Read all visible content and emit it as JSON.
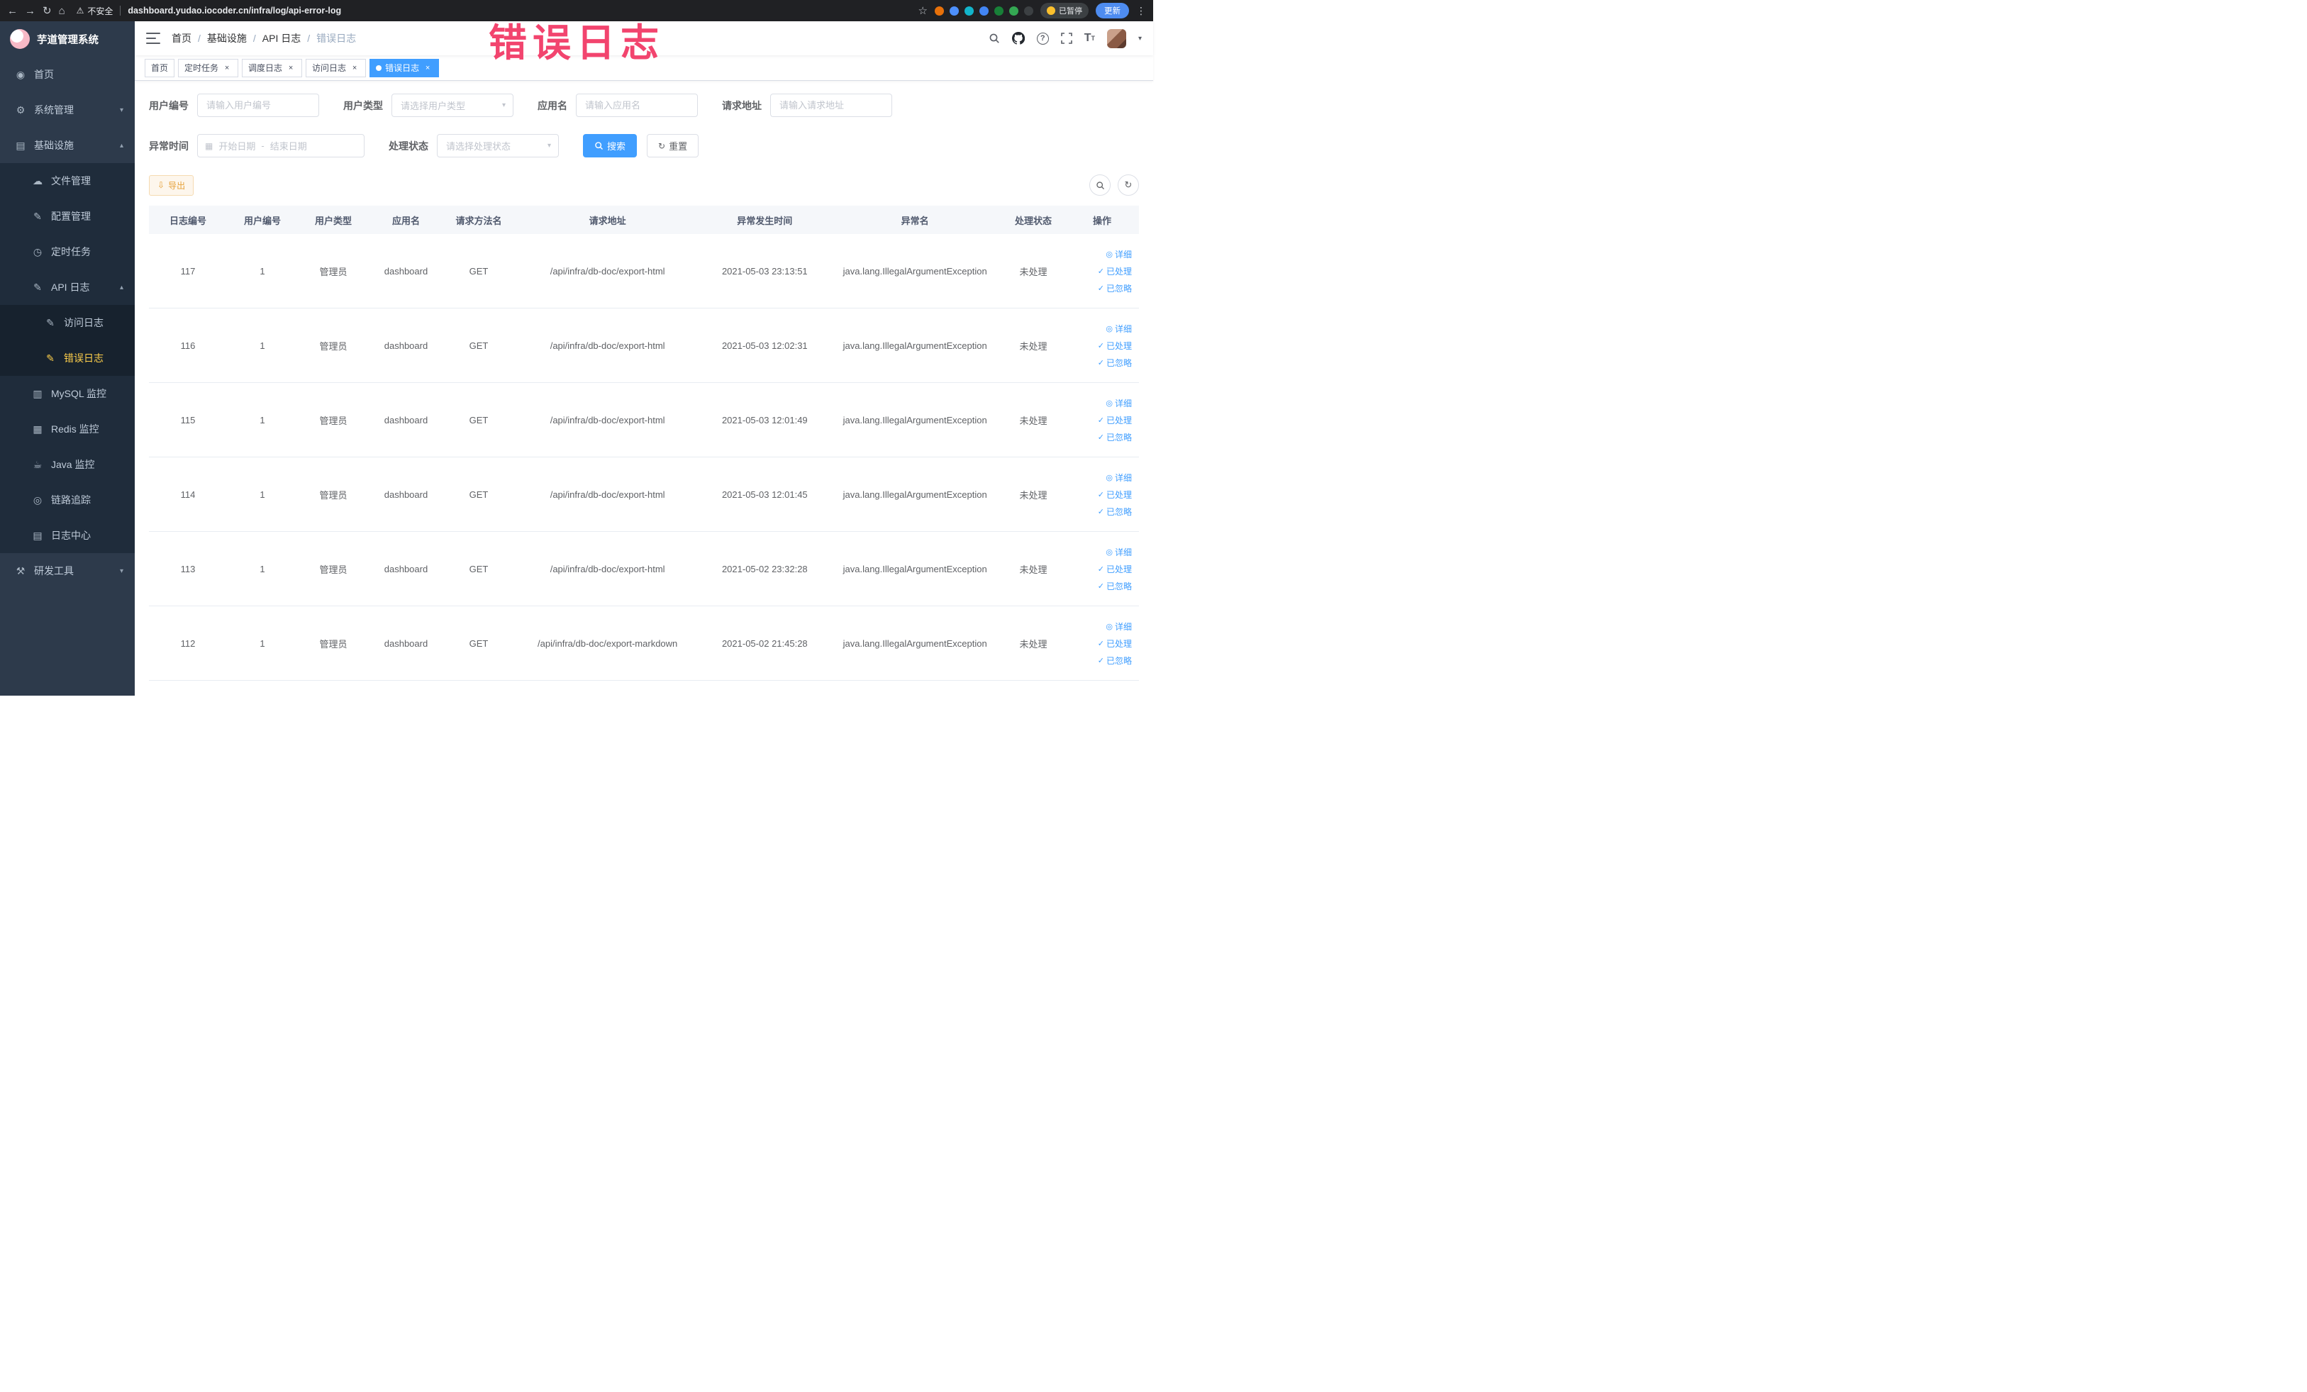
{
  "browser": {
    "security_label": "不安全",
    "url": "dashboard.yudao.iocoder.cn/infra/log/api-error-log",
    "paused_badge": "已暂停",
    "update_button": "更新",
    "extension_colors": [
      "#e8710a",
      "#4d90fe",
      "#12b5cb",
      "#4285f4",
      "#188038",
      "#34a853",
      "#3c4043"
    ]
  },
  "annotation": {
    "text": "错误日志",
    "color": "#f2446e"
  },
  "sidebar": {
    "logo_title": "芋道管理系统",
    "menu": [
      {
        "name": "home",
        "label": "首页",
        "glyph": "◉",
        "level": 0
      },
      {
        "name": "system-management",
        "label": "系统管理",
        "glyph": "⚙",
        "level": 0,
        "arrow": "down"
      },
      {
        "name": "infrastructure",
        "label": "基础设施",
        "glyph": "▤",
        "level": 0,
        "arrow": "up"
      },
      {
        "name": "file-management",
        "label": "文件管理",
        "glyph": "☁",
        "level": 1,
        "sub": true
      },
      {
        "name": "config-management",
        "label": "配置管理",
        "glyph": "✎",
        "level": 1,
        "sub": true
      },
      {
        "name": "scheduled-jobs",
        "label": "定时任务",
        "glyph": "◷",
        "level": 1,
        "sub": true
      },
      {
        "name": "api-logs",
        "label": "API 日志",
        "glyph": "✎",
        "level": 1,
        "sub": true,
        "arrow": "up"
      },
      {
        "name": "access-logs",
        "label": "访问日志",
        "glyph": "✎",
        "level": 2,
        "sub": true
      },
      {
        "name": "error-logs",
        "label": "错误日志",
        "glyph": "✎",
        "level": 2,
        "sub": true,
        "active": true
      },
      {
        "name": "mysql-monitor",
        "label": "MySQL 监控",
        "glyph": "▥",
        "level": 1,
        "sub": true
      },
      {
        "name": "redis-monitor",
        "label": "Redis 监控",
        "glyph": "▦",
        "level": 1,
        "sub": true
      },
      {
        "name": "java-monitor",
        "label": "Java 监控",
        "glyph": "☕",
        "level": 1,
        "sub": true
      },
      {
        "name": "link-tracing",
        "label": "链路追踪",
        "glyph": "◎",
        "level": 1,
        "sub": true
      },
      {
        "name": "log-center",
        "label": "日志中心",
        "glyph": "▤",
        "level": 1,
        "sub": true
      },
      {
        "name": "dev-tools",
        "label": "研发工具",
        "glyph": "⚒",
        "level": 0,
        "arrow": "down"
      }
    ]
  },
  "breadcrumb": [
    "首页",
    "基础设施",
    "API 日志",
    "错误日志"
  ],
  "tabs": [
    {
      "name": "home",
      "label": "首页",
      "closable": false,
      "active": false
    },
    {
      "name": "scheduled-jobs",
      "label": "定时任务",
      "closable": true,
      "active": false
    },
    {
      "name": "schedule-logs",
      "label": "调度日志",
      "closable": true,
      "active": false
    },
    {
      "name": "access-logs",
      "label": "访问日志",
      "closable": true,
      "active": false
    },
    {
      "name": "error-logs",
      "label": "错误日志",
      "closable": true,
      "active": true
    }
  ],
  "filters": {
    "user_id": {
      "label": "用户编号",
      "placeholder": "请输入用户编号"
    },
    "user_type": {
      "label": "用户类型",
      "placeholder": "请选择用户类型"
    },
    "app_name": {
      "label": "应用名",
      "placeholder": "请输入应用名"
    },
    "request_url": {
      "label": "请求地址",
      "placeholder": "请输入请求地址"
    },
    "exception_time": {
      "label": "异常时间",
      "start_placeholder": "开始日期",
      "separator": "-",
      "end_placeholder": "结束日期"
    },
    "process_status": {
      "label": "处理状态",
      "placeholder": "请选择处理状态"
    },
    "search_button": "搜索",
    "reset_button": "重置"
  },
  "toolbar": {
    "export_button": "导出"
  },
  "table": {
    "columns": [
      "日志编号",
      "用户编号",
      "用户类型",
      "应用名",
      "请求方法名",
      "请求地址",
      "异常发生时间",
      "异常名",
      "处理状态",
      "操作"
    ],
    "action_labels": {
      "detail": "详细",
      "processed": "已处理",
      "ignored": "已忽略"
    },
    "rows": [
      {
        "log_id": "117",
        "user_id": "1",
        "user_type": "管理员",
        "app_name": "dashboard",
        "method": "GET",
        "url": "/api/infra/db-doc/export-html",
        "time": "2021-05-03 23:13:51",
        "exception": "java.lang.IllegalArgumentException",
        "status": "未处理"
      },
      {
        "log_id": "116",
        "user_id": "1",
        "user_type": "管理员",
        "app_name": "dashboard",
        "method": "GET",
        "url": "/api/infra/db-doc/export-html",
        "time": "2021-05-03 12:02:31",
        "exception": "java.lang.IllegalArgumentException",
        "status": "未处理"
      },
      {
        "log_id": "115",
        "user_id": "1",
        "user_type": "管理员",
        "app_name": "dashboard",
        "method": "GET",
        "url": "/api/infra/db-doc/export-html",
        "time": "2021-05-03 12:01:49",
        "exception": "java.lang.IllegalArgumentException",
        "status": "未处理"
      },
      {
        "log_id": "114",
        "user_id": "1",
        "user_type": "管理员",
        "app_name": "dashboard",
        "method": "GET",
        "url": "/api/infra/db-doc/export-html",
        "time": "2021-05-03 12:01:45",
        "exception": "java.lang.IllegalArgumentException",
        "status": "未处理"
      },
      {
        "log_id": "113",
        "user_id": "1",
        "user_type": "管理员",
        "app_name": "dashboard",
        "method": "GET",
        "url": "/api/infra/db-doc/export-html",
        "time": "2021-05-02 23:32:28",
        "exception": "java.lang.IllegalArgumentException",
        "status": "未处理"
      },
      {
        "log_id": "112",
        "user_id": "1",
        "user_type": "管理员",
        "app_name": "dashboard",
        "method": "GET",
        "url": "/api/infra/db-doc/export-markdown",
        "time": "2021-05-02 21:45:28",
        "exception": "java.lang.IllegalArgumentException",
        "status": "未处理"
      }
    ]
  }
}
